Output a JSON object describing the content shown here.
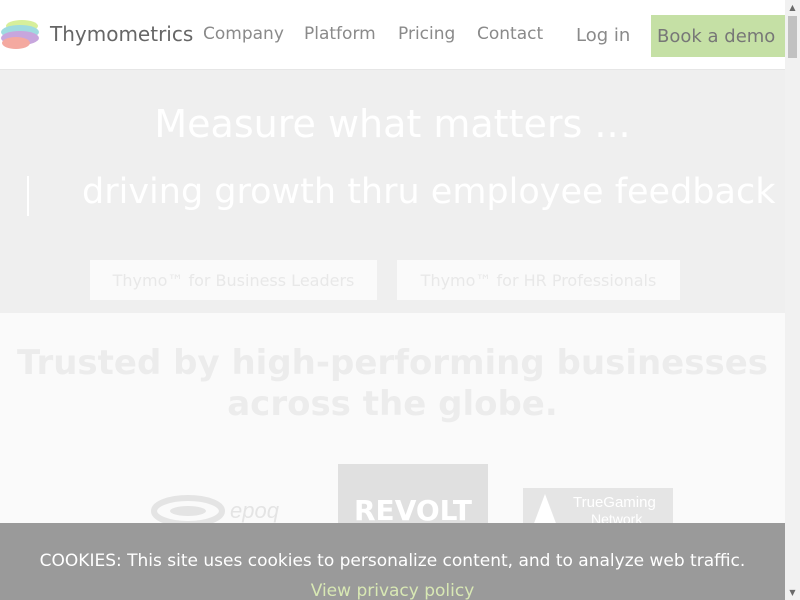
{
  "nav": {
    "brand": "Thymometrics",
    "links": [
      "Company",
      "Platform",
      "Pricing",
      "Contact"
    ],
    "login": "Log in",
    "demo": "Book a demo"
  },
  "hero": {
    "title": "Measure what matters ...",
    "subtitle": "driving growth thru employee feedback",
    "cta_leaders": "Thymo™ for Business Leaders",
    "cta_hr": "Thymo™ for HR Professionals"
  },
  "trusted": {
    "title": "Trusted by high-performing businesses across the globe.",
    "logos": {
      "epoq": "epoq",
      "revolt": "REVOLT",
      "tgn_line1": "TrueGaming",
      "tgn_line2": "Network"
    }
  },
  "cookie": {
    "text": "COOKIES: This site uses cookies to personalize content, and to analyze web traffic.",
    "link": "View privacy policy"
  },
  "colors": {
    "demo_button": "#c5e0a5",
    "cookie_bar": "#9a9a9a",
    "privacy_link": "#d8e8b4"
  },
  "icons": {
    "logo": "layered-petals-logo",
    "scroll_up": "triangle-up",
    "scroll_down": "triangle-down"
  }
}
